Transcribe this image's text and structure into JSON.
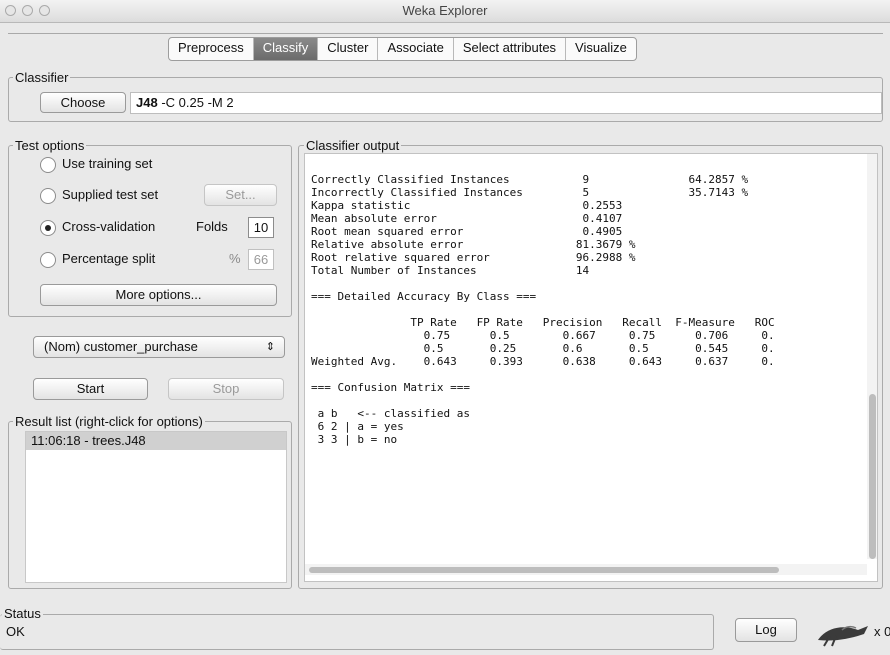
{
  "window": {
    "title": "Weka Explorer"
  },
  "tabs": [
    "Preprocess",
    "Classify",
    "Cluster",
    "Associate",
    "Select attributes",
    "Visualize"
  ],
  "classifier": {
    "group_label": "Classifier",
    "choose_label": "Choose",
    "name": "J48",
    "options": "-C 0.25 -M 2"
  },
  "test_options": {
    "group_label": "Test options",
    "use_training": "Use training set",
    "supplied_test": "Supplied test set",
    "set_label": "Set...",
    "cross_validation": "Cross-validation",
    "folds_label": "Folds",
    "folds_value": "10",
    "percentage_split": "Percentage split",
    "percent_sign": "%",
    "percent_value": "66",
    "more_options": "More options..."
  },
  "class_attribute": "(Nom) customer_purchase",
  "start_label": "Start",
  "stop_label": "Stop",
  "result_list": {
    "group_label": "Result list (right-click for options)",
    "items": [
      "11:06:18 - trees.J48"
    ]
  },
  "output": {
    "group_label": "Classifier output",
    "text": "Correctly Classified Instances           9               64.2857 %\nIncorrectly Classified Instances         5               35.7143 %\nKappa statistic                          0.2553\nMean absolute error                      0.4107\nRoot mean squared error                  0.4905\nRelative absolute error                 81.3679 %\nRoot relative squared error             96.2988 %\nTotal Number of Instances               14\n\n=== Detailed Accuracy By Class ===\n\n               TP Rate   FP Rate   Precision   Recall  F-Measure   ROC\n                 0.75      0.5        0.667     0.75      0.706     0.\n                 0.5       0.25       0.6       0.5       0.545     0.\nWeighted Avg.    0.643     0.393      0.638     0.643     0.637     0.\n\n=== Confusion Matrix ===\n\n a b   <-- classified as\n 6 2 | a = yes\n 3 3 | b = no"
  },
  "status": {
    "group_label": "Status",
    "text": "OK",
    "log_label": "Log",
    "count": "x 0"
  }
}
